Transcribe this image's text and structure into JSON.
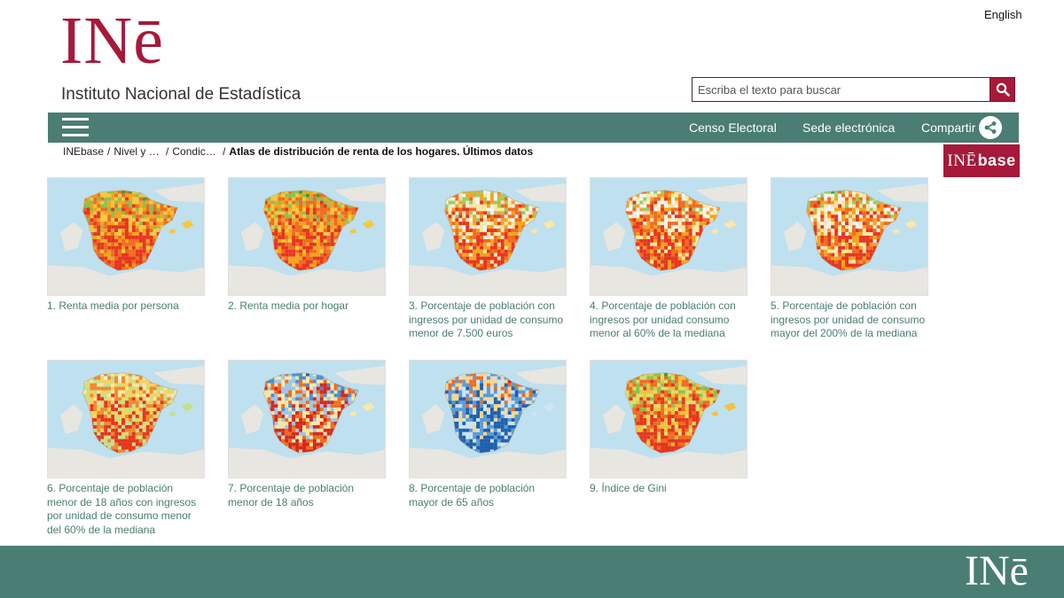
{
  "header": {
    "logo_text": "INē",
    "institute_name": "Instituto Nacional de Estadística",
    "language_link": "English"
  },
  "search": {
    "placeholder": "Escriba el texto para buscar",
    "value": ""
  },
  "nav": {
    "links": [
      "Censo Electoral",
      "Sede electrónica",
      "Compartir"
    ]
  },
  "breadcrumb": {
    "items": [
      "INEbase",
      "Nivel y …",
      "Condic…"
    ],
    "current": "Atlas de distribución de renta de los hogares. Últimos datos"
  },
  "badge": {
    "prefix": "INĒ",
    "suffix": "base"
  },
  "maps": [
    {
      "caption": "1. Renta media por persona",
      "palette": "red-green"
    },
    {
      "caption": "2. Renta media por hogar",
      "palette": "red-green"
    },
    {
      "caption": "3. Porcentaje de población con ingresos por unidad de consumo menor de 7.500 euros",
      "palette": "red-green-light"
    },
    {
      "caption": "4. Porcentaje de población con ingresos por unidad consumo menor al 60% de la mediana",
      "palette": "red-green-light"
    },
    {
      "caption": "5. Porcentaje de población con ingresos por unidad de consumo mayor del 200% de la mediana",
      "palette": "red-green-light"
    },
    {
      "caption": "6. Porcentaje de población menor de 18 años con ingresos por unidad de consumo menor del 60% de la mediana",
      "palette": "pale"
    },
    {
      "caption": "7. Porcentaje de población menor de 18 años",
      "palette": "blue-red"
    },
    {
      "caption": "8. Porcentaje de población mayor de 65 años",
      "palette": "red-blue"
    },
    {
      "caption": "9. Índice de Gini",
      "palette": "green-mixed"
    }
  ],
  "footer": {
    "logo_text": "INē"
  },
  "colors": {
    "brand_red": "#a6193a",
    "brand_green": "#4a7d73",
    "sea": "#bfe0ee",
    "land": "#e8e6e1"
  }
}
